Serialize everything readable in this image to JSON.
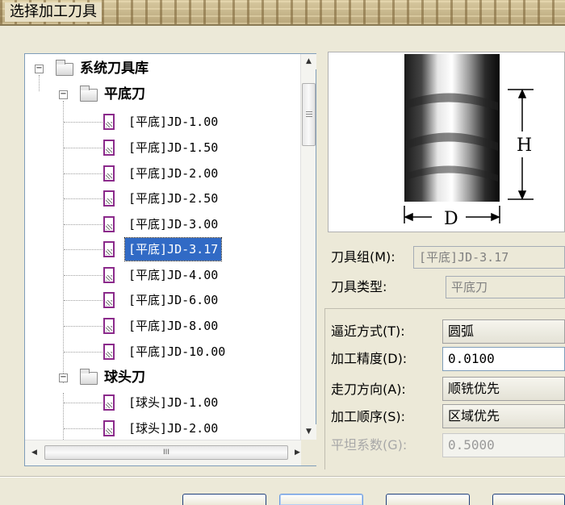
{
  "window": {
    "title": "选择加工刀具"
  },
  "tree": {
    "root": {
      "label": "系统刀具库",
      "expanded": true
    },
    "groups": [
      {
        "label": "平底刀",
        "expanded": true,
        "items": [
          "[平底]JD-1.00",
          "[平底]JD-1.50",
          "[平底]JD-2.00",
          "[平底]JD-2.50",
          "[平底]JD-3.00",
          "[平底]JD-3.17",
          "[平底]JD-4.00",
          "[平底]JD-6.00",
          "[平底]JD-8.00",
          "[平底]JD-10.00"
        ]
      },
      {
        "label": "球头刀",
        "expanded": true,
        "items": [
          "[球头]JD-1.00",
          "[球头]JD-2.00"
        ]
      }
    ],
    "selected": "[平底]JD-3.17",
    "hscroll_grip": "III"
  },
  "preview": {
    "dim_h": "H",
    "dim_d": "D"
  },
  "info": {
    "group_label": "刀具组(M):",
    "group_value": "[平底]JD-3.17",
    "type_label": "刀具类型:",
    "type_value": "平底刀"
  },
  "params": {
    "approach_label": "逼近方式(T):",
    "approach_value": "圆弧",
    "precision_label": "加工精度(D):",
    "precision_value": "0.0100",
    "direction_label": "走刀方向(A):",
    "direction_value": "顺铣优先",
    "order_label": "加工顺序(S):",
    "order_value": "区域优先",
    "flat_label": "平坦系数(G):",
    "flat_value": "0.5000"
  },
  "colors": {
    "selection": "#316ac5",
    "tool_icon": "#8b2a8b"
  }
}
